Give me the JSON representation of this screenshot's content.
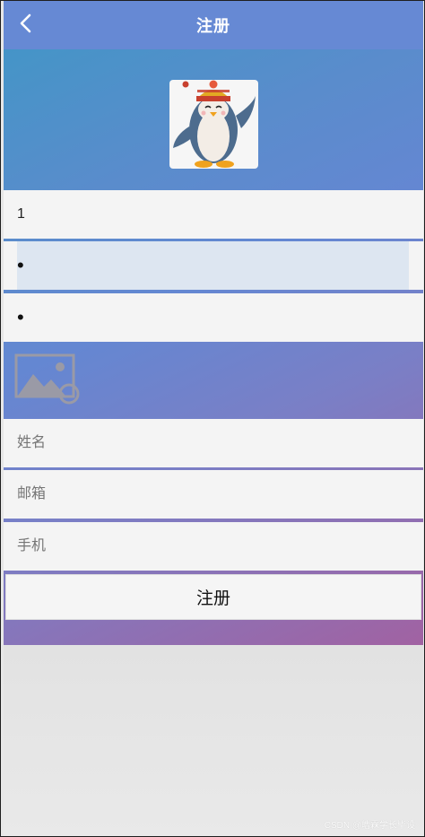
{
  "header": {
    "title": "注册",
    "back_icon": "chevron-left-icon"
  },
  "avatar": {
    "icon": "penguin-avatar-icon"
  },
  "form": {
    "username_value": "1",
    "password_value": "•",
    "confirm_password_value": "•",
    "image_picker_icon": "image-placeholder-icon",
    "name_placeholder": "姓名",
    "email_placeholder": "邮箱",
    "phone_placeholder": "手机"
  },
  "buttons": {
    "register_label": "注册"
  },
  "watermark": "CSDN @皓霖学长毕设",
  "colors": {
    "header": "#6689d4",
    "gradient_start": "#3f97c6",
    "gradient_mid": "#6487d2",
    "gradient_end": "#a162a2",
    "field_bg": "#f4f4f4",
    "active_field_bg": "#dde6f1"
  }
}
